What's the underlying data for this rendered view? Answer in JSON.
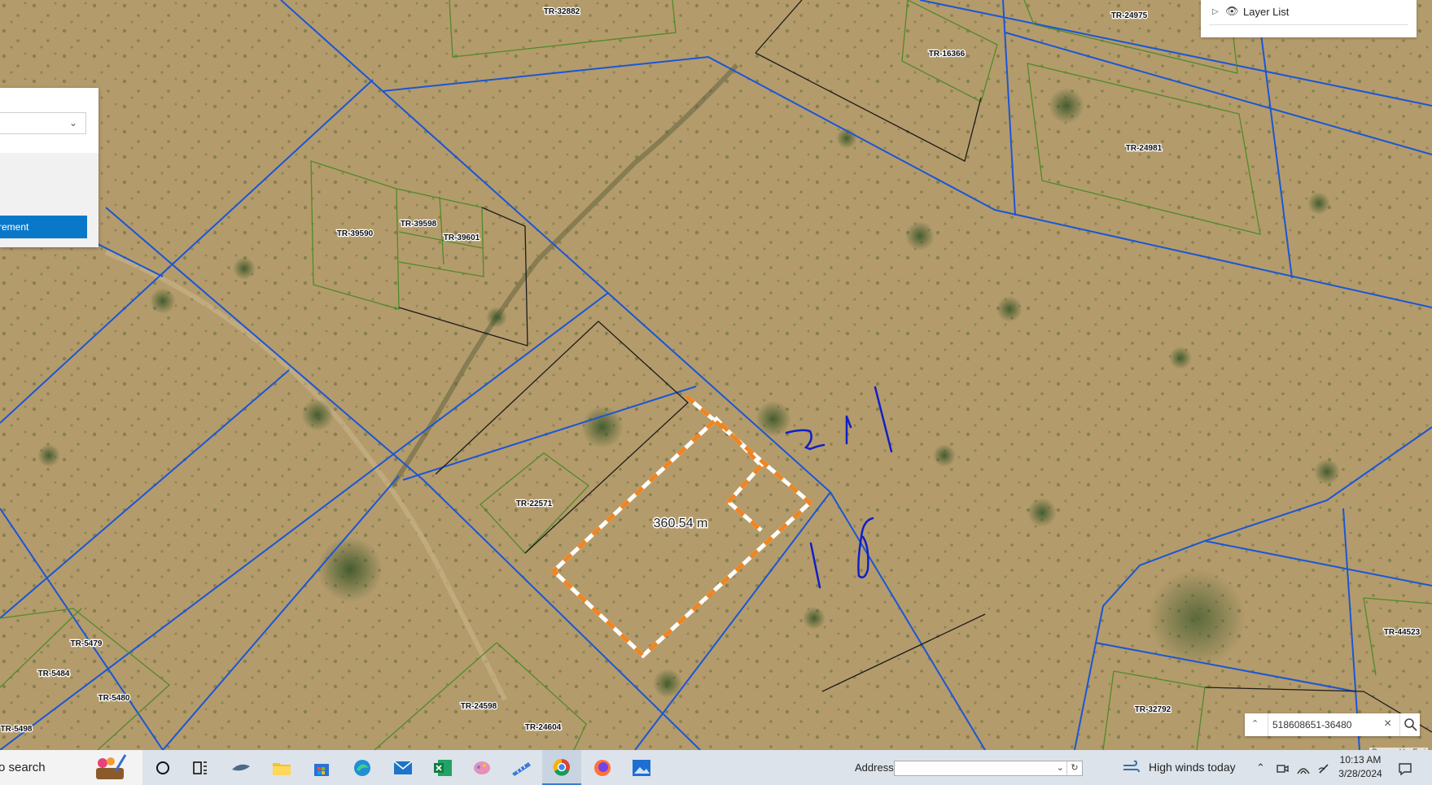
{
  "map": {
    "parcel_labels": [
      "TR-32882",
      "TR-24975",
      "TR-16366",
      "TR-24981",
      "TR-39590",
      "TR-39598",
      "TR-39601",
      "TR-22571",
      "TR-5479",
      "TR-5484",
      "TR-5480",
      "TR-5498",
      "TR-24598",
      "TR-24604",
      "TR-32792",
      "TR-44523"
    ],
    "measurement_result": "360.54 m",
    "colors": {
      "parcel_blue": "#1a56d6",
      "parcel_green": "#4f8a2a",
      "parcel_black": "#1b1b1b",
      "measure_orange": "#f2841f",
      "measure_white": "#ffffff",
      "ink": "#1020c8"
    }
  },
  "measure_widget": {
    "button_label": "rement",
    "dropdown_icon": "chevron-down-icon"
  },
  "layer_list": {
    "label": "Layer List",
    "icons": [
      "expand-triangle-icon",
      "eye-icon"
    ]
  },
  "search_widget": {
    "value": "518608651-36480",
    "icons": [
      "chevron-up-icon",
      "clear-icon",
      "search-icon"
    ]
  },
  "attribution": "Powered by Esri",
  "taskbar": {
    "search_text": "o search",
    "apps": [
      "paint-icon",
      "cortana-icon",
      "task-view-icon",
      "snipping-icon",
      "file-explorer-icon",
      "store-icon",
      "edge-icon",
      "mail-icon",
      "excel-icon",
      "paint-3d-icon",
      "ruler-icon",
      "chrome-icon",
      "firefox-icon",
      "photos-icon"
    ],
    "address_label": "Address",
    "address_value": "",
    "weather": "High winds today",
    "time": "10:13 AM",
    "date": "3/28/2024"
  }
}
